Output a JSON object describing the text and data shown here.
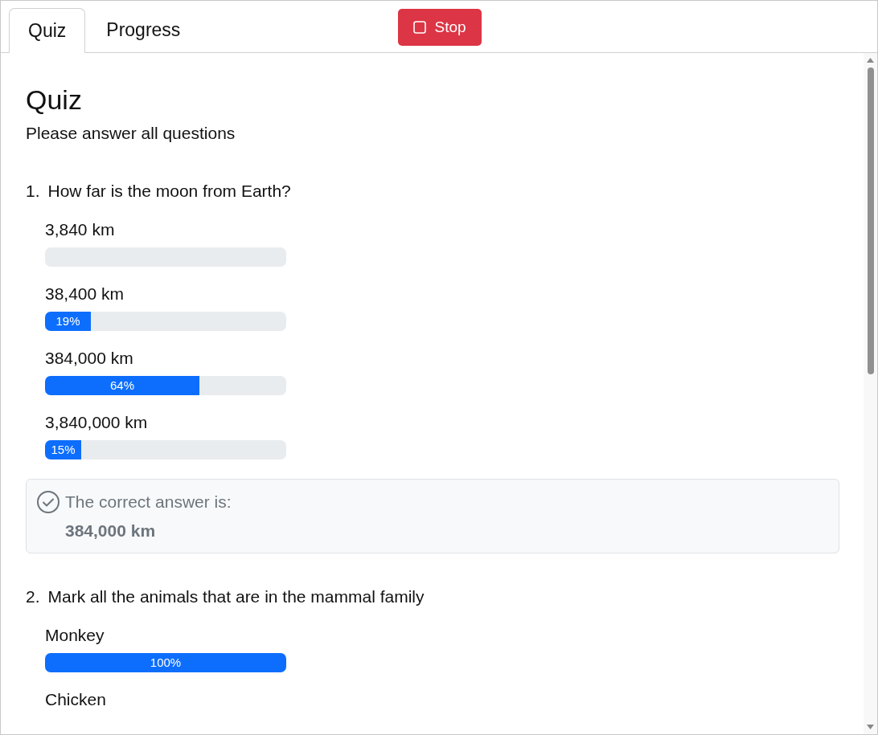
{
  "tabs": [
    {
      "label": "Quiz",
      "selected": true
    },
    {
      "label": "Progress",
      "selected": false
    }
  ],
  "stop_button": {
    "label": "Stop"
  },
  "quiz": {
    "title": "Quiz",
    "subtitle": "Please answer all questions",
    "questions": [
      {
        "number": "1.",
        "text": "How far is the moon from Earth?",
        "options": [
          {
            "kind": "bar",
            "label": "3,840 km"
          },
          {
            "kind": "bar",
            "label": "38,400 km",
            "level": 0.19,
            "reading": "19%"
          },
          {
            "kind": "bar",
            "label": "384,000 km",
            "level": 0.64,
            "reading": "64%"
          },
          {
            "kind": "bar",
            "label": "3,840,000 km",
            "level": 0.15,
            "reading": "15%"
          }
        ],
        "answer": {
          "label": "The correct answer is:",
          "value": "384,000 km"
        }
      },
      {
        "number": "2.",
        "text": "Mark all the animals that are in the mammal family",
        "options": [
          {
            "kind": "bar",
            "label": "Monkey",
            "level": 1,
            "reading": "100%"
          },
          {
            "kind": "label",
            "label": "Chicken"
          }
        ]
      }
    ]
  }
}
